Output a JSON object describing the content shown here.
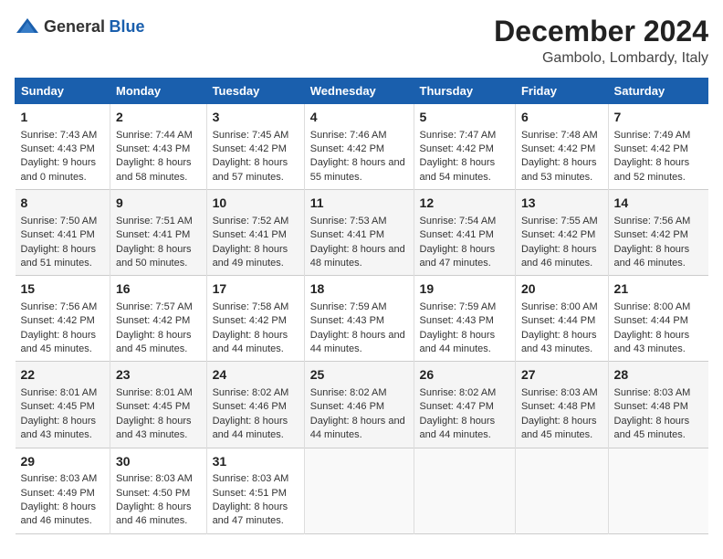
{
  "header": {
    "logo_general": "General",
    "logo_blue": "Blue",
    "title": "December 2024",
    "subtitle": "Gambolo, Lombardy, Italy"
  },
  "columns": [
    "Sunday",
    "Monday",
    "Tuesday",
    "Wednesday",
    "Thursday",
    "Friday",
    "Saturday"
  ],
  "weeks": [
    [
      {
        "day": "1",
        "sunrise": "7:43 AM",
        "sunset": "4:43 PM",
        "daylight": "9 hours and 0 minutes."
      },
      {
        "day": "2",
        "sunrise": "7:44 AM",
        "sunset": "4:43 PM",
        "daylight": "8 hours and 58 minutes."
      },
      {
        "day": "3",
        "sunrise": "7:45 AM",
        "sunset": "4:42 PM",
        "daylight": "8 hours and 57 minutes."
      },
      {
        "day": "4",
        "sunrise": "7:46 AM",
        "sunset": "4:42 PM",
        "daylight": "8 hours and 55 minutes."
      },
      {
        "day": "5",
        "sunrise": "7:47 AM",
        "sunset": "4:42 PM",
        "daylight": "8 hours and 54 minutes."
      },
      {
        "day": "6",
        "sunrise": "7:48 AM",
        "sunset": "4:42 PM",
        "daylight": "8 hours and 53 minutes."
      },
      {
        "day": "7",
        "sunrise": "7:49 AM",
        "sunset": "4:42 PM",
        "daylight": "8 hours and 52 minutes."
      }
    ],
    [
      {
        "day": "8",
        "sunrise": "7:50 AM",
        "sunset": "4:41 PM",
        "daylight": "8 hours and 51 minutes."
      },
      {
        "day": "9",
        "sunrise": "7:51 AM",
        "sunset": "4:41 PM",
        "daylight": "8 hours and 50 minutes."
      },
      {
        "day": "10",
        "sunrise": "7:52 AM",
        "sunset": "4:41 PM",
        "daylight": "8 hours and 49 minutes."
      },
      {
        "day": "11",
        "sunrise": "7:53 AM",
        "sunset": "4:41 PM",
        "daylight": "8 hours and 48 minutes."
      },
      {
        "day": "12",
        "sunrise": "7:54 AM",
        "sunset": "4:41 PM",
        "daylight": "8 hours and 47 minutes."
      },
      {
        "day": "13",
        "sunrise": "7:55 AM",
        "sunset": "4:42 PM",
        "daylight": "8 hours and 46 minutes."
      },
      {
        "day": "14",
        "sunrise": "7:56 AM",
        "sunset": "4:42 PM",
        "daylight": "8 hours and 46 minutes."
      }
    ],
    [
      {
        "day": "15",
        "sunrise": "7:56 AM",
        "sunset": "4:42 PM",
        "daylight": "8 hours and 45 minutes."
      },
      {
        "day": "16",
        "sunrise": "7:57 AM",
        "sunset": "4:42 PM",
        "daylight": "8 hours and 45 minutes."
      },
      {
        "day": "17",
        "sunrise": "7:58 AM",
        "sunset": "4:42 PM",
        "daylight": "8 hours and 44 minutes."
      },
      {
        "day": "18",
        "sunrise": "7:59 AM",
        "sunset": "4:43 PM",
        "daylight": "8 hours and 44 minutes."
      },
      {
        "day": "19",
        "sunrise": "7:59 AM",
        "sunset": "4:43 PM",
        "daylight": "8 hours and 44 minutes."
      },
      {
        "day": "20",
        "sunrise": "8:00 AM",
        "sunset": "4:44 PM",
        "daylight": "8 hours and 43 minutes."
      },
      {
        "day": "21",
        "sunrise": "8:00 AM",
        "sunset": "4:44 PM",
        "daylight": "8 hours and 43 minutes."
      }
    ],
    [
      {
        "day": "22",
        "sunrise": "8:01 AM",
        "sunset": "4:45 PM",
        "daylight": "8 hours and 43 minutes."
      },
      {
        "day": "23",
        "sunrise": "8:01 AM",
        "sunset": "4:45 PM",
        "daylight": "8 hours and 43 minutes."
      },
      {
        "day": "24",
        "sunrise": "8:02 AM",
        "sunset": "4:46 PM",
        "daylight": "8 hours and 44 minutes."
      },
      {
        "day": "25",
        "sunrise": "8:02 AM",
        "sunset": "4:46 PM",
        "daylight": "8 hours and 44 minutes."
      },
      {
        "day": "26",
        "sunrise": "8:02 AM",
        "sunset": "4:47 PM",
        "daylight": "8 hours and 44 minutes."
      },
      {
        "day": "27",
        "sunrise": "8:03 AM",
        "sunset": "4:48 PM",
        "daylight": "8 hours and 45 minutes."
      },
      {
        "day": "28",
        "sunrise": "8:03 AM",
        "sunset": "4:48 PM",
        "daylight": "8 hours and 45 minutes."
      }
    ],
    [
      {
        "day": "29",
        "sunrise": "8:03 AM",
        "sunset": "4:49 PM",
        "daylight": "8 hours and 46 minutes."
      },
      {
        "day": "30",
        "sunrise": "8:03 AM",
        "sunset": "4:50 PM",
        "daylight": "8 hours and 46 minutes."
      },
      {
        "day": "31",
        "sunrise": "8:03 AM",
        "sunset": "4:51 PM",
        "daylight": "8 hours and 47 minutes."
      },
      null,
      null,
      null,
      null
    ]
  ],
  "labels": {
    "sunrise": "Sunrise:",
    "sunset": "Sunset:",
    "daylight": "Daylight:"
  }
}
